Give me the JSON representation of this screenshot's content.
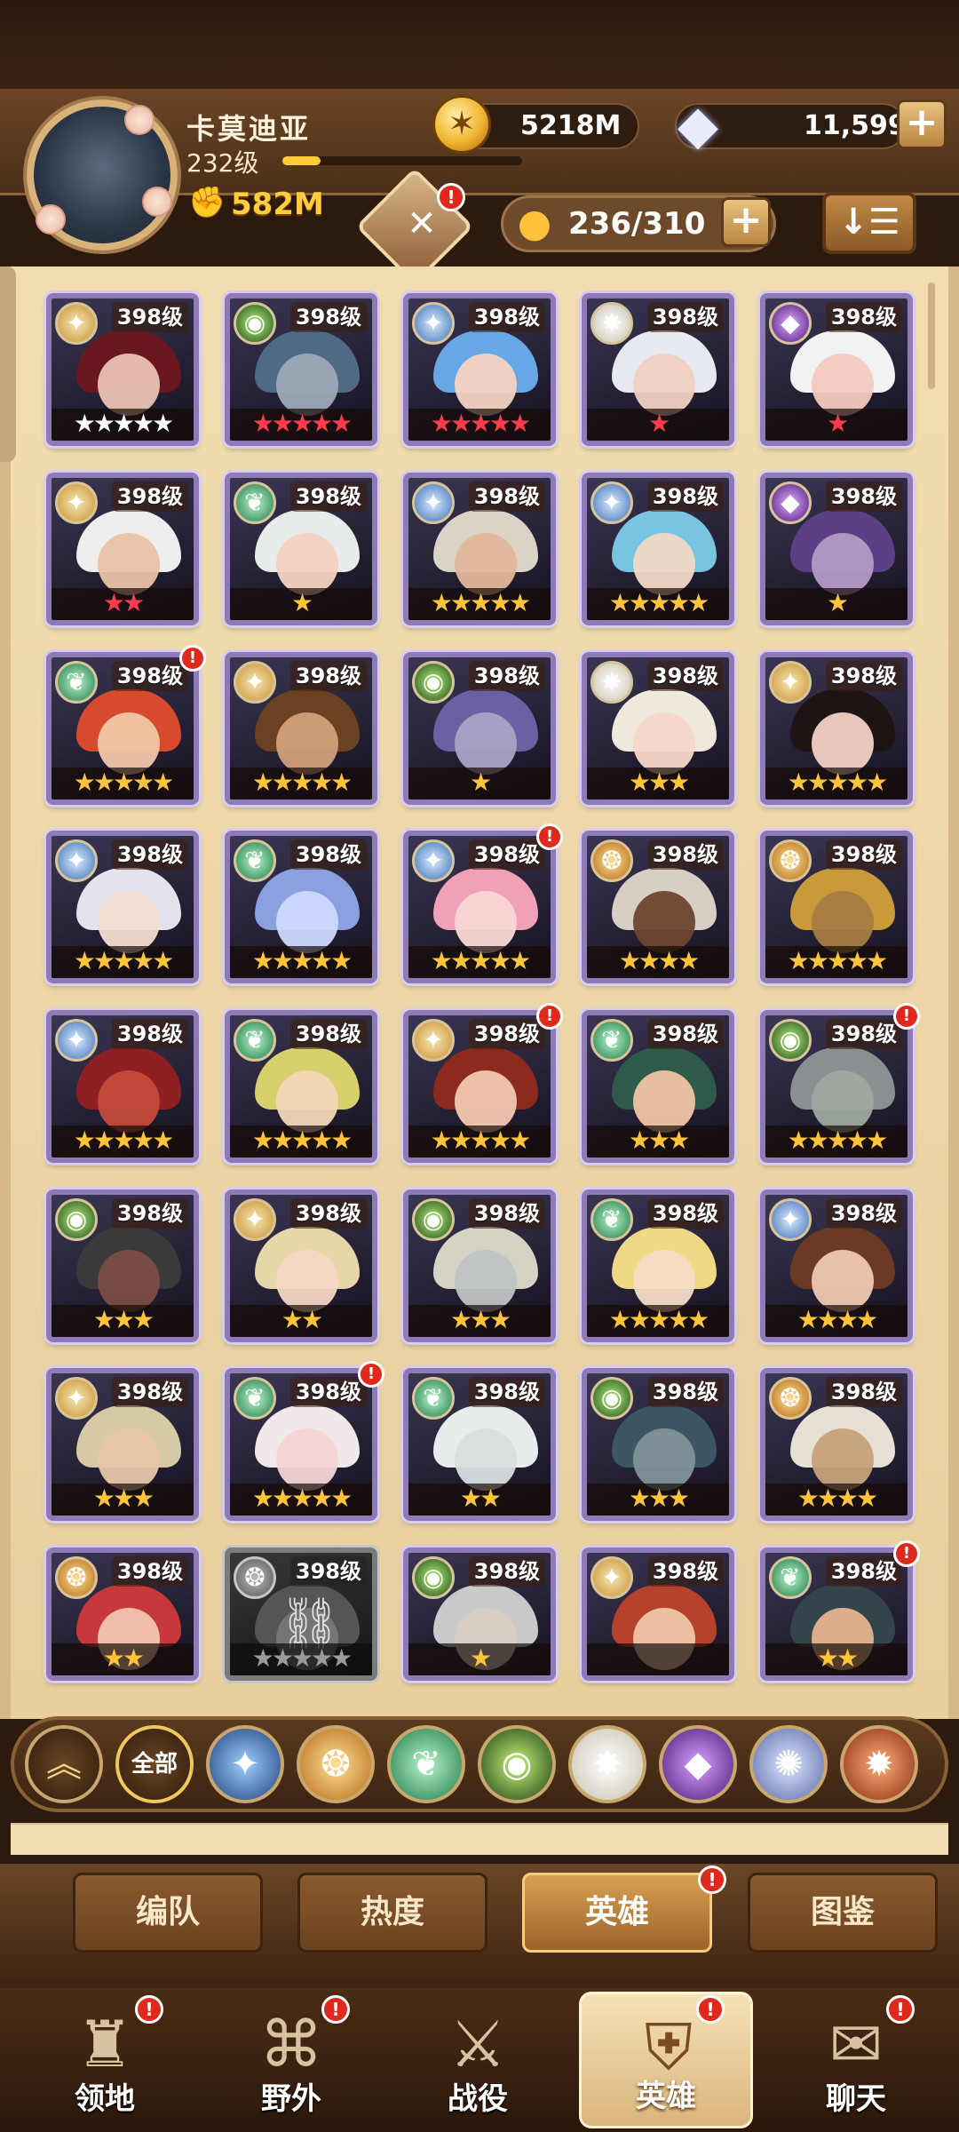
{
  "player": {
    "name": "卡莫迪亚",
    "level": "232级",
    "xp_fraction": 0.16,
    "power": "582M"
  },
  "resources": {
    "gold": "5218M",
    "gems": "11,599",
    "plus": "+"
  },
  "roster": {
    "hero_count": "236/310",
    "sort_label": "↓☰"
  },
  "colors": {
    "gold": "#ffcd3e",
    "badge_red": "#e0291d",
    "card_border": "#8f7ab8"
  },
  "heroes": [
    {
      "level": "398级",
      "faction": "celestial",
      "stars": "★★★★★",
      "star_color": "#ffffff",
      "badge": false,
      "hair": "#6a1720",
      "skin": "#e9c2b3"
    },
    {
      "level": "398级",
      "faction": "graveborn",
      "stars": "★★★★★",
      "star_color": "#ff3b4d",
      "badge": false,
      "hair": "#4e6a85",
      "skin": "#9da8b6"
    },
    {
      "level": "398级",
      "faction": "celestial-blue",
      "stars": "★★★★★",
      "star_color": "#ff3b4d",
      "badge": false,
      "hair": "#67a7e6",
      "skin": "#f4d3c2"
    },
    {
      "level": "398级",
      "faction": "lightbearer",
      "stars": "★",
      "star_color": "#ff3b4d",
      "badge": false,
      "hair": "#e6e9ef",
      "skin": "#f0d1c1"
    },
    {
      "level": "398级",
      "faction": "hypogean",
      "stars": "★",
      "star_color": "#ff3b4d",
      "badge": false,
      "hair": "#f2f2f2",
      "skin": "#f3c9c0"
    },
    {
      "level": "398级",
      "faction": "celestial",
      "stars": "★★",
      "star_color": "#ff3b4d",
      "badge": false,
      "hair": "#eeeeee",
      "skin": "#e9c2a7"
    },
    {
      "level": "398级",
      "faction": "wilder",
      "stars": "★",
      "star_color": "#ffc43a",
      "badge": false,
      "hair": "#e6ece9",
      "skin": "#f3d3c2"
    },
    {
      "level": "398级",
      "faction": "celestial-blue",
      "stars": "★★★★★",
      "star_color": "#ffc43a",
      "badge": false,
      "hair": "#d9d4c6",
      "skin": "#e2b79a"
    },
    {
      "level": "398级",
      "faction": "celestial-blue",
      "stars": "★★★★★",
      "star_color": "#ffc43a",
      "badge": false,
      "hair": "#78c5e1",
      "skin": "#f3d8c6"
    },
    {
      "level": "398级",
      "faction": "hypogean",
      "stars": "★",
      "star_color": "#ffc43a",
      "badge": false,
      "hair": "#5d3f86",
      "skin": "#b49ac6"
    },
    {
      "level": "398级",
      "faction": "wilder",
      "stars": "★★★★★",
      "star_color": "#ffc43a",
      "badge": true,
      "hair": "#d74a2e",
      "skin": "#f1c7a8"
    },
    {
      "level": "398级",
      "faction": "celestial",
      "stars": "★★★★★",
      "star_color": "#ffc43a",
      "badge": false,
      "hair": "#6b4221",
      "skin": "#d3a07a"
    },
    {
      "level": "398级",
      "faction": "graveborn",
      "stars": "★",
      "star_color": "#ffc43a",
      "badge": false,
      "hair": "#6d5fa3",
      "skin": "#a9a3c6"
    },
    {
      "level": "398级",
      "faction": "lightbearer",
      "stars": "★★★",
      "star_color": "#ffc43a",
      "badge": false,
      "hair": "#efe8dc",
      "skin": "#f6d8c8"
    },
    {
      "level": "398级",
      "faction": "celestial",
      "stars": "★★★★★",
      "star_color": "#ffc43a",
      "badge": false,
      "hair": "#1e1414",
      "skin": "#f2d1c3"
    },
    {
      "level": "398级",
      "faction": "celestial-blue",
      "stars": "★★★★★",
      "star_color": "#ffc43a",
      "badge": false,
      "hair": "#e4e2ec",
      "skin": "#f4dcd0"
    },
    {
      "level": "398级",
      "faction": "wilder",
      "stars": "★★★★★",
      "star_color": "#ffc43a",
      "badge": false,
      "hair": "#8aa0e0",
      "skin": "#cfd9ff"
    },
    {
      "level": "398级",
      "faction": "celestial-blue",
      "stars": "★★★★★",
      "star_color": "#ffc43a",
      "badge": true,
      "hair": "#f0a1b7",
      "skin": "#fad7d6"
    },
    {
      "level": "398级",
      "faction": "mauler",
      "stars": "★★★★",
      "star_color": "#ffc43a",
      "badge": false,
      "hair": "#d8cfc4",
      "skin": "#6b4630"
    },
    {
      "level": "398级",
      "faction": "mauler",
      "stars": "★★★★★",
      "star_color": "#ffc43a",
      "badge": false,
      "hair": "#c89a3a",
      "skin": "#a67c42"
    },
    {
      "level": "398级",
      "faction": "celestial-blue",
      "stars": "★★★★★",
      "star_color": "#ffc43a",
      "badge": false,
      "hair": "#8e1f22",
      "skin": "#c44a3b"
    },
    {
      "level": "398级",
      "faction": "wilder",
      "stars": "★★★★★",
      "star_color": "#ffc43a",
      "badge": false,
      "hair": "#d7d06c",
      "skin": "#f2d7b8"
    },
    {
      "level": "398级",
      "faction": "celestial",
      "stars": "★★★★★",
      "star_color": "#ffc43a",
      "badge": true,
      "hair": "#8c2a1e",
      "skin": "#f2c8b1"
    },
    {
      "level": "398级",
      "faction": "wilder",
      "stars": "★★★",
      "star_color": "#ffc43a",
      "badge": false,
      "hair": "#2e5a4a",
      "skin": "#f1c5a4"
    },
    {
      "level": "398级",
      "faction": "graveborn",
      "stars": "★★★★★",
      "star_color": "#ffc43a",
      "badge": true,
      "hair": "#8a8f92",
      "skin": "#9fa8a0"
    },
    {
      "level": "398级",
      "faction": "graveborn",
      "stars": "★★★",
      "star_color": "#ffc43a",
      "badge": false,
      "hair": "#3a3a3a",
      "skin": "#7a4d45"
    },
    {
      "level": "398级",
      "faction": "celestial",
      "stars": "★★",
      "star_color": "#ffc43a",
      "badge": false,
      "hair": "#e7d6a8",
      "skin": "#f3d7c4"
    },
    {
      "level": "398级",
      "faction": "graveborn",
      "stars": "★★★",
      "star_color": "#ffc43a",
      "badge": false,
      "hair": "#d6d2c4",
      "skin": "#bfc3c5"
    },
    {
      "level": "398级",
      "faction": "wilder",
      "stars": "★★★★★",
      "star_color": "#ffc43a",
      "badge": false,
      "hair": "#f0d985",
      "skin": "#f6dcc6"
    },
    {
      "level": "398级",
      "faction": "celestial-blue",
      "stars": "★★★★",
      "star_color": "#ffc43a",
      "badge": false,
      "hair": "#6b3a24",
      "skin": "#efc9b0"
    },
    {
      "level": "398级",
      "faction": "celestial",
      "stars": "★★★",
      "star_color": "#ffc43a",
      "badge": false,
      "hair": "#d8c9a6",
      "skin": "#e8c5a8"
    },
    {
      "level": "398级",
      "faction": "wilder",
      "stars": "★★★★★",
      "star_color": "#ffc43a",
      "badge": true,
      "hair": "#f1e9e9",
      "skin": "#f4d5d5"
    },
    {
      "level": "398级",
      "faction": "wilder",
      "stars": "★★",
      "star_color": "#ffc43a",
      "badge": false,
      "hair": "#e8ecec",
      "skin": "#d9dedf"
    },
    {
      "level": "398级",
      "faction": "graveborn",
      "stars": "★★★",
      "star_color": "#ffc43a",
      "badge": false,
      "hair": "#3e5566",
      "skin": "#7f9498"
    },
    {
      "level": "398级",
      "faction": "mauler",
      "stars": "★★★★",
      "star_color": "#ffc43a",
      "badge": false,
      "hair": "#e7e0d6",
      "skin": "#c7a17a"
    },
    {
      "level": "398级",
      "faction": "mauler",
      "stars": "★★",
      "star_color": "#ffc43a",
      "badge": false,
      "hair": "#c6383a",
      "skin": "#f2c4b0"
    },
    {
      "level": "398级",
      "faction": "locked",
      "stars": "★★★★★",
      "star_color": "#9a9a9a",
      "badge": false,
      "locked": true,
      "hair": "#555555",
      "skin": "#777777"
    },
    {
      "level": "398级",
      "faction": "graveborn",
      "stars": "★",
      "star_color": "#ffc43a",
      "badge": false,
      "hair": "#c9c9c9",
      "skin": "#d7cfc5"
    },
    {
      "level": "398级",
      "faction": "celestial",
      "stars": "",
      "star_color": "#ffc43a",
      "badge": false,
      "hair": "#b6422b",
      "skin": "#edc7a8"
    },
    {
      "level": "398级",
      "faction": "wilder",
      "stars": "★★",
      "star_color": "#ffc43a",
      "badge": true,
      "hair": "#33444a",
      "skin": "#e6b48e"
    }
  ],
  "filters": [
    {
      "name": "collapse",
      "label": "︽"
    },
    {
      "name": "all",
      "label": "全部"
    },
    {
      "name": "lightbearer",
      "label": "✦"
    },
    {
      "name": "mauler",
      "label": "❂"
    },
    {
      "name": "wilder",
      "label": "❦"
    },
    {
      "name": "graveborn",
      "label": "◉"
    },
    {
      "name": "celestial",
      "label": "✸"
    },
    {
      "name": "hypogean",
      "label": "◆"
    },
    {
      "name": "dimensional",
      "label": "✺"
    },
    {
      "name": "fire",
      "label": "✹"
    }
  ],
  "subtabs": [
    {
      "label": "编队",
      "active": false,
      "badge": false
    },
    {
      "label": "热度",
      "active": false,
      "badge": false
    },
    {
      "label": "英雄",
      "active": true,
      "badge": true
    },
    {
      "label": "图鉴",
      "active": false,
      "badge": false
    }
  ],
  "nav": [
    {
      "label": "领地",
      "icon": "castle-icon",
      "glyph": "♜",
      "badge": true,
      "active": false
    },
    {
      "label": "野外",
      "icon": "map-icon",
      "glyph": "⌘",
      "badge": true,
      "active": false
    },
    {
      "label": "战役",
      "icon": "sword-icon",
      "glyph": "⚔",
      "badge": false,
      "active": false
    },
    {
      "label": "英雄",
      "icon": "hero-helmet-icon",
      "glyph": "⛨",
      "badge": true,
      "active": true
    },
    {
      "label": "聊天",
      "icon": "chat-icon",
      "glyph": "✉",
      "badge": true,
      "active": false
    }
  ],
  "badge_mark": "!"
}
